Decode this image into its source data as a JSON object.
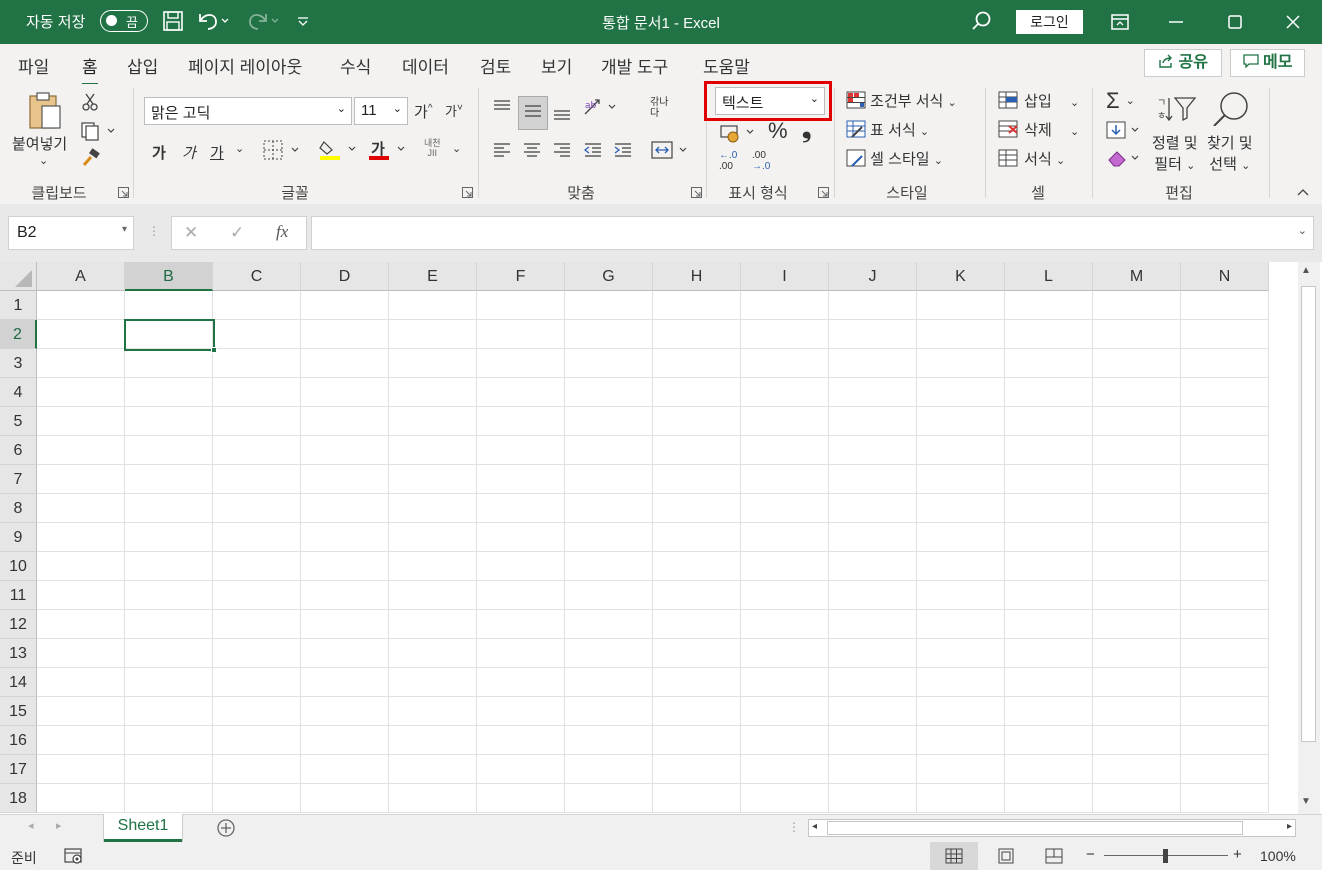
{
  "titlebar": {
    "autosave_label": "자동 저장",
    "autosave_state": "끔",
    "doc_title": "통합 문서1  -  Excel",
    "login_label": "로그인"
  },
  "menu": {
    "items": [
      "파일",
      "홈",
      "삽입",
      "페이지 레이아웃",
      "수식",
      "데이터",
      "검토",
      "보기",
      "개발 도구",
      "도움말"
    ],
    "active": "홈",
    "share_label": "공유",
    "memo_label": "메모"
  },
  "ribbon": {
    "clipboard": {
      "paste_label": "붙여넣기",
      "group_label": "클립보드"
    },
    "font": {
      "font_name": "맑은 고딕",
      "font_size": "11",
      "bold": "가",
      "italic": "가",
      "underline": "가",
      "grow": "가",
      "shrink": "가",
      "phonetic_top": "내천",
      "phonetic_bottom": "JII",
      "font_color_glyph": "가",
      "group_label": "글꼴"
    },
    "alignment": {
      "wrap_glyph_top": "갂나",
      "wrap_glyph_bottom": "다",
      "group_label": "맞춤"
    },
    "number": {
      "format_value": "텍스트",
      "percent": "%",
      "comma": "❟",
      "inc_top": "←.0",
      "inc_bottom": ".00",
      "dec_top": ".00",
      "dec_bottom": "→.0",
      "group_label": "표시 형식"
    },
    "styles": {
      "conditional": "조건부 서식",
      "table": "표 서식",
      "cell": "셀 스타일",
      "group_label": "스타일"
    },
    "cells": {
      "insert": "삽입",
      "delete": "삭제",
      "format": "서식",
      "group_label": "셀"
    },
    "editing": {
      "sum": "Σ",
      "sort_top": "정렬 및",
      "sort_bottom": "필터",
      "find_top": "찾기 및",
      "find_bottom": "선택",
      "group_label": "편집"
    }
  },
  "formula_bar": {
    "name_box": "B2",
    "cancel": "✕",
    "enter": "✓",
    "fx": "fx",
    "formula": ""
  },
  "grid": {
    "columns": [
      "A",
      "B",
      "C",
      "D",
      "E",
      "F",
      "G",
      "H",
      "I",
      "J",
      "K",
      "L",
      "M",
      "N"
    ],
    "rows": [
      "1",
      "2",
      "3",
      "4",
      "5",
      "6",
      "7",
      "8",
      "9",
      "10",
      "11",
      "12",
      "13",
      "14",
      "15",
      "16",
      "17",
      "18"
    ],
    "selected_column": "B",
    "selected_row": "2"
  },
  "sheets": {
    "tabs": [
      "Sheet1"
    ],
    "active": "Sheet1"
  },
  "status": {
    "ready": "준비",
    "zoom": "100%"
  },
  "colors": {
    "accent": "#217346",
    "highlight": "#e00000"
  }
}
